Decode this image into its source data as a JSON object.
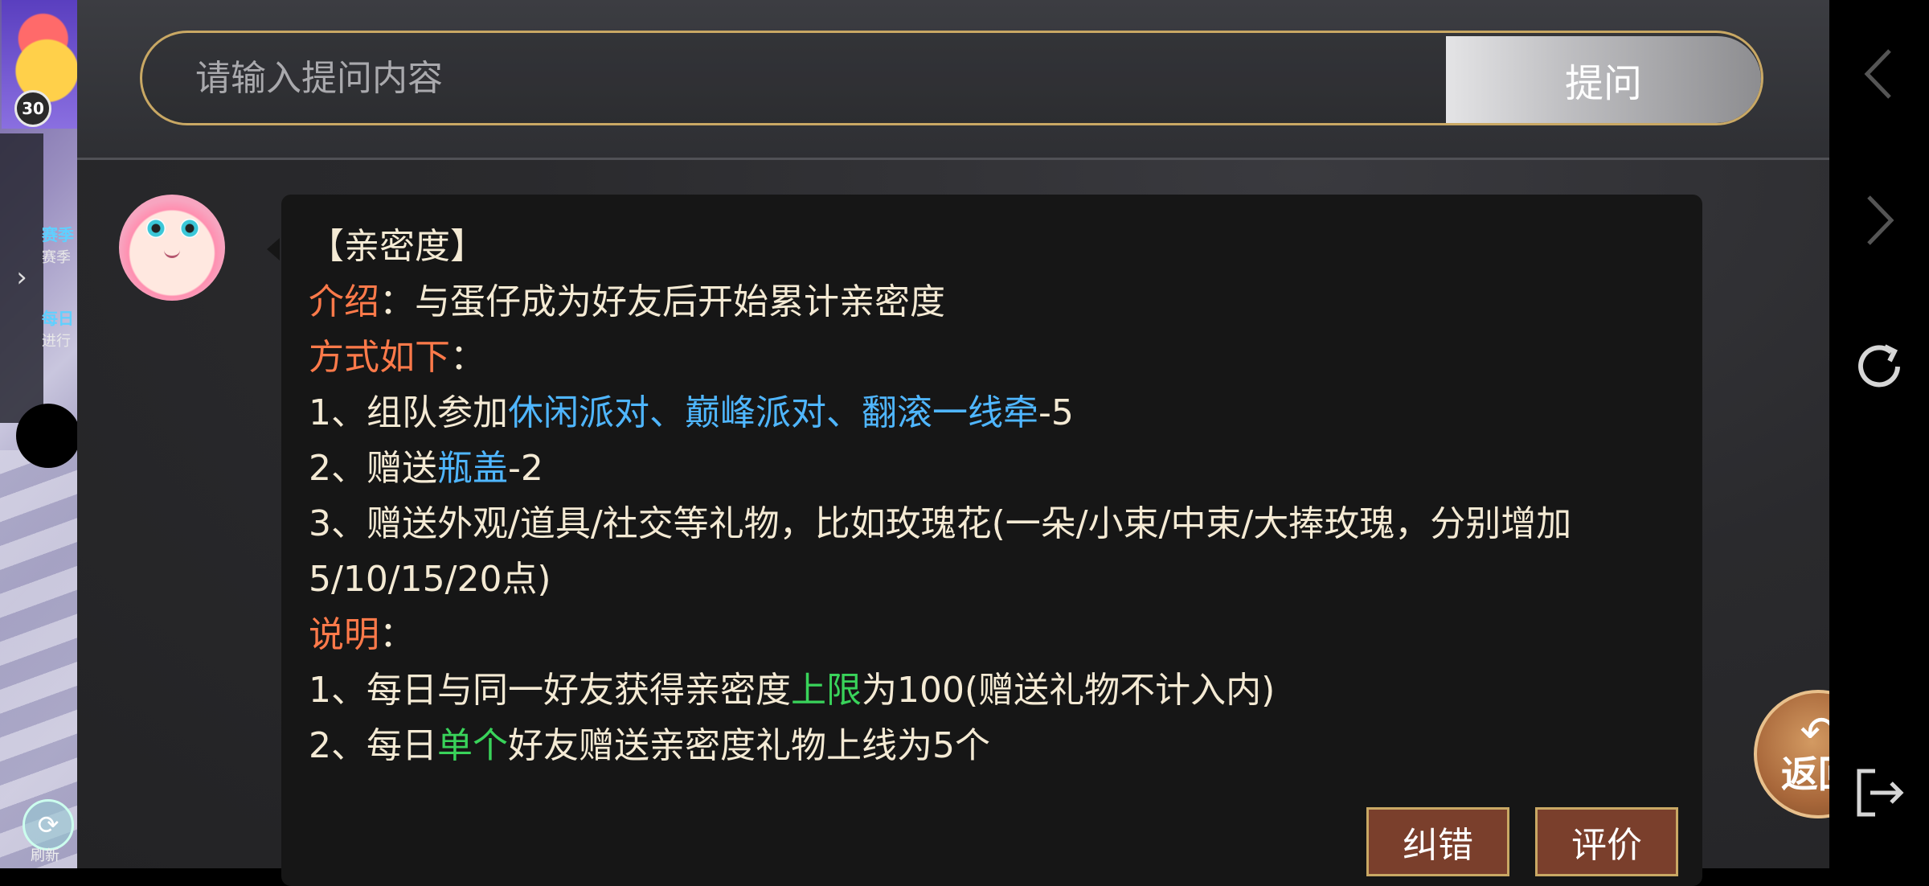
{
  "search": {
    "placeholder": "请输入提问内容",
    "button_label": "提问"
  },
  "game_strip": {
    "level": "30",
    "season_label": "赛季",
    "season_sub": "赛季",
    "daily_label": "每日",
    "daily_sub": "进行",
    "refresh_label": "刷新"
  },
  "answer": {
    "title": "【亲密度】",
    "intro_key": "介绍",
    "intro_text": "：与蛋仔成为好友后开始累计亲密度",
    "method_key": "方式如下",
    "method_colon": "：",
    "m1_prefix": "1、组队参加",
    "m1_highlight": "休闲派对、巅峰派对、翻滚一线牵",
    "m1_suffix": "-5",
    "m2_prefix": "2、赠送",
    "m2_highlight": "瓶盖",
    "m2_suffix": "-2",
    "m3_text": "3、赠送外观/道具/社交等礼物，比如玫瑰花(一朵/小束/中束/大捧玫瑰，分别增加5/10/15/20点)",
    "note_key": "说明",
    "note_colon": "：",
    "n1_prefix": "1、每日与同一好友获得亲密度",
    "n1_highlight": "上限",
    "n1_suffix": "为100(赠送礼物不计入内)",
    "n2_prefix": "2、每日",
    "n2_highlight": "单个",
    "n2_suffix": "好友赠送亲密度礼物上线为5个"
  },
  "actions": {
    "report_error": "纠错",
    "rate": "评价",
    "back": "返回"
  },
  "colors": {
    "accent_gold": "#c9a864",
    "key_orange": "#ff7a4a",
    "link_blue": "#4fb6ff",
    "highlight_green": "#39d35a"
  },
  "icons": {
    "back": "back-arrow-icon",
    "nav_back": "chevron-left-icon",
    "nav_forward": "chevron-right-icon",
    "nav_refresh": "refresh-icon",
    "nav_exit": "exit-icon"
  }
}
